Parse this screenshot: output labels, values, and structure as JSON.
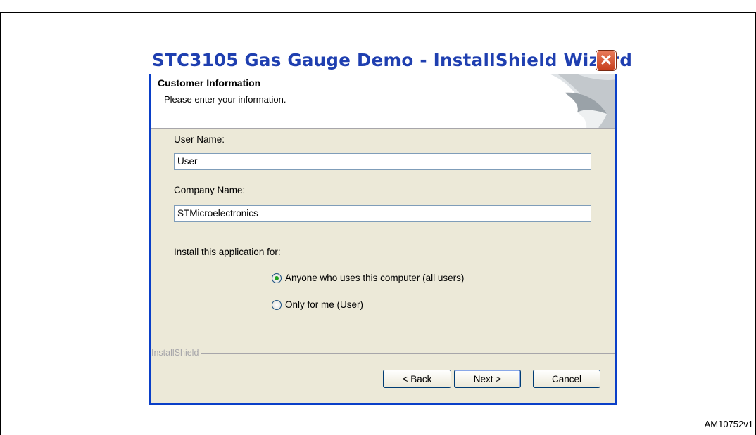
{
  "figure": {
    "header": "",
    "code": "AM10752v1"
  },
  "window": {
    "title": "STC3105 Gas Gauge Demo - InstallShield Wizard",
    "close_glyph": "✕"
  },
  "banner": {
    "title": "Customer Information",
    "subtitle": "Please enter your information."
  },
  "form": {
    "user_name_label": "User Name:",
    "user_name_value": "User",
    "company_label": "Company Name:",
    "company_value": "STMicroelectronics",
    "install_for_label": "Install this application for:",
    "options": [
      {
        "label": "Anyone who uses this computer (all users)",
        "selected": true
      },
      {
        "label": "Only for me (User)",
        "selected": false
      }
    ]
  },
  "footer": {
    "brand": "InstallShield",
    "back_label": "< Back",
    "next_label": "Next >",
    "cancel_label": "Cancel"
  },
  "colors": {
    "title_text": "#1f3fb0",
    "window_border": "#0a3fc8",
    "dialog_bg": "#ece9d8",
    "radio_selected": "#21a121"
  },
  "icons": {
    "close": "close-icon",
    "banner_art": "wizard-banner-graphic"
  }
}
